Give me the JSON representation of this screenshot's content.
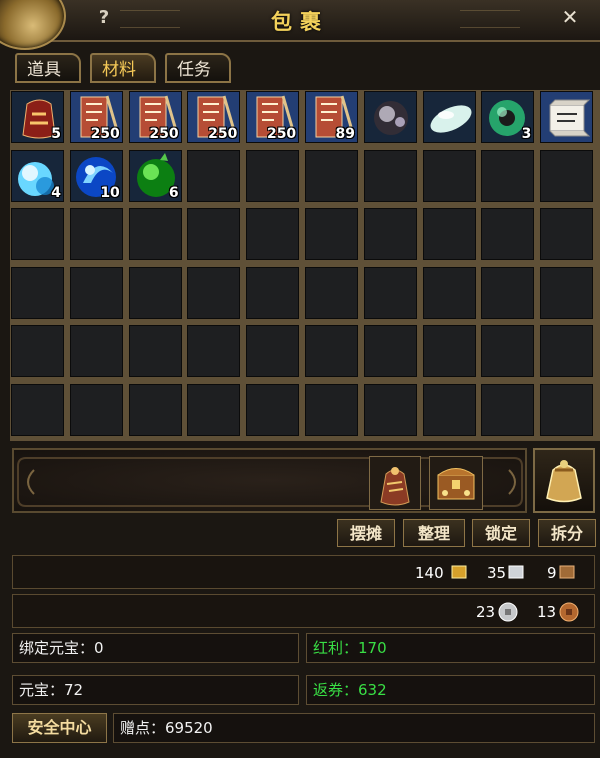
{
  "title": "包裹",
  "help_symbol": "?",
  "close_symbol": "✕",
  "tabs": [
    "道具",
    "材料",
    "任务"
  ],
  "active_tab": "材料",
  "items": [
    {
      "icon": "red-pouch-icon",
      "count": "5"
    },
    {
      "icon": "scroll-icon",
      "count": "250"
    },
    {
      "icon": "scroll-icon",
      "count": "250"
    },
    {
      "icon": "scroll-icon",
      "count": "250"
    },
    {
      "icon": "scroll-icon",
      "count": "250"
    },
    {
      "icon": "scroll-icon",
      "count": "89"
    },
    {
      "icon": "dark-ore-icon",
      "count": ""
    },
    {
      "icon": "white-jade-icon",
      "count": ""
    },
    {
      "icon": "green-jade-disc-icon",
      "count": "3"
    },
    {
      "icon": "paper-scroll-icon",
      "count": ""
    },
    {
      "icon": "blue-crystal-icon",
      "count": "4"
    },
    {
      "icon": "blue-orb-icon",
      "count": "10"
    },
    {
      "icon": "green-orb-icon",
      "count": "6"
    }
  ],
  "actions": [
    "摆摊",
    "整理",
    "锁定",
    "拆分"
  ],
  "currency": {
    "gold": "140",
    "silver": "35",
    "bronze": "9",
    "coin_silver": "23",
    "coin_bronze": "13"
  },
  "fields": {
    "bound_yuanbao": "绑定元宝：0",
    "bonus": "红利：170",
    "yuanbao": "元宝：72",
    "coupon": "返券：632",
    "gift_points": "赠点：69520"
  },
  "safety_center": "安全中心"
}
